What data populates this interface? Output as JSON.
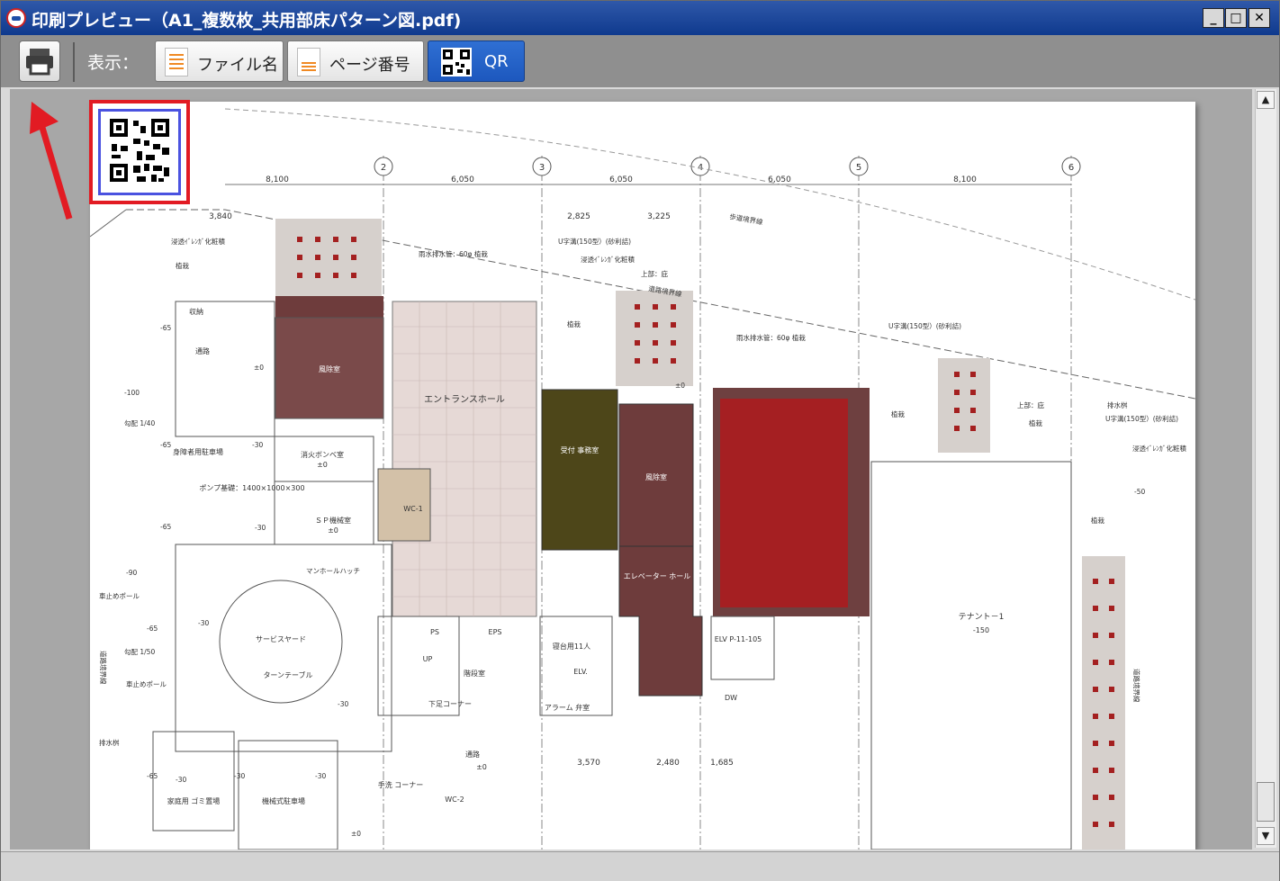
{
  "window": {
    "title": "印刷プレビュー（A1_複数枚_共用部床パターン図.pdf)",
    "minimize": "_",
    "maximize": "□",
    "close": "✕"
  },
  "toolbar": {
    "display_label": "表示：",
    "buttons": [
      {
        "label": "ファイル名",
        "active": false
      },
      {
        "label": "ページ番号",
        "active": false
      },
      {
        "label": "QR",
        "active": true
      }
    ]
  },
  "plan": {
    "axis_numbers": [
      "2",
      "3",
      "4",
      "5",
      "6"
    ],
    "top_dimensions": [
      "8,100",
      "6,050",
      "6,050",
      "6,050",
      "8,100"
    ],
    "sub_dimensions": [
      "3,840",
      "2,825",
      "3,225"
    ],
    "bottom_dimensions": [
      "3,570",
      "2,480",
      "1,685"
    ],
    "rooms": {
      "entrance_hall": "エントランスホール",
      "window_room_1": "風除室",
      "window_room_2": "風除室",
      "reception": "受付\n事務室",
      "elevator_hall": "エレベーター\nホール",
      "tenant": "テナント－1",
      "tenant_level": "-150",
      "fire_pump": "消火ボンベ室",
      "fire_pump_level": "±0",
      "sp_room": "ＳＰ機械室",
      "sp_level": "±0",
      "service_yard": "サービスヤード",
      "turntable": "ターンテーブル",
      "disabled_parking": "身障者用駐車場",
      "pump_base": "ポンプ基礎：1400×1000×300",
      "wc1": "WC-1",
      "wc2": "WC-2",
      "stairs": "階段室",
      "elv": "ELV.",
      "bed_elv": "寝台用11人",
      "elv2": "ELV\nP-11-105",
      "garbage": "家庭用\nゴミ置場",
      "parking": "機械式駐車場",
      "passage": "通路",
      "passage_level": "±0",
      "storage": "収納",
      "corridor": "通路",
      "ps": "PS",
      "eps": "EPS",
      "dw": "DW",
      "shoe": "下足コーナー",
      "alarm": "アラーム\n弁室",
      "hand": "手洗\nコーナー"
    },
    "notes": {
      "boundary": "歩道境界線",
      "road_boundary": "道路境界線",
      "rain_pipe": "雨水排水管：60φ\n植栽",
      "u_gutter": "U字溝(150型）(砂利詰)",
      "filter": "浸透ｲﾞﾚﾝｶﾞ化粧積",
      "upper": "上部：庇",
      "planting": "植栽",
      "slope1": "勾配 1/40",
      "slope2": "勾配 1/50",
      "car_stop": "車止めポール",
      "drain": "排水桝",
      "manhole": "マンホールハッチ",
      "level_minus100": "-100",
      "level_minus65": "-65",
      "level_minus30": "-30",
      "level_minus90": "-90",
      "level_minus50": "-50",
      "level_zero": "±0",
      "up": "UP",
      "road_right": "道路境界線",
      "road_left": "道路境界線"
    }
  },
  "colors": {
    "accent_red": "#e21b23",
    "maroon": "#6e3c3c",
    "olive": "#4d4619",
    "bright_red": "#a51f22",
    "active_blue": "#1f5ec4"
  }
}
